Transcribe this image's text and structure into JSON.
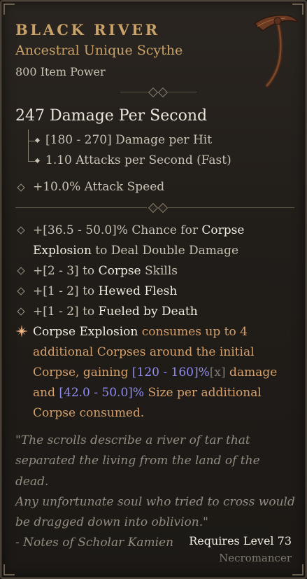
{
  "item": {
    "name": "BLACK RIVER",
    "type": "Ancestral Unique Scythe",
    "power": "800 Item Power",
    "icon": "scythe-icon"
  },
  "stats": {
    "dps": "247 Damage Per Second",
    "damage_per_hit": "[180 - 270] Damage per Hit",
    "attacks_per_second": "1.10 Attacks per Second (Fast)",
    "implicit": "+10.0% Attack Speed"
  },
  "affixes": [
    {
      "pre": "+[36.5 - 50.0]% Chance for ",
      "hl": "Corpse",
      "line2_hl": "Explosion",
      "line2_post": " to Deal Double Damage"
    },
    {
      "pre": "+[2 - 3] to ",
      "hl": "Corpse",
      "post": " Skills"
    },
    {
      "pre": "+[1 - 2] to ",
      "hl": "Hewed Flesh"
    },
    {
      "pre": "+[1 - 2] to ",
      "hl": "Fueled by Death"
    }
  ],
  "unique_power": {
    "l1_skill": "Corpse Explosion",
    "l1_rest": " consumes up to 4",
    "l2": "additional Corpses around the initial",
    "l3_pre": "Corpse, gaining ",
    "l3_range": "[120 - 160]%",
    "l3_x": "[x]",
    "l3_post": " damage",
    "l4_pre": "and ",
    "l4_range": "[42.0 - 50.0]%",
    "l4_post": " Size per additional",
    "l5": "Corpse consumed."
  },
  "flavor": {
    "l1": "\"The scrolls describe a river of tar that",
    "l2": "separated the living from the land of the dead.",
    "l3": "Any unfortunate soul who tried to cross would",
    "l4": "be dragged down into oblivion.\"",
    "l5": "- Notes of Scholar Kamien"
  },
  "requirements": {
    "level": "Requires Level 73",
    "class": "Necromancer"
  },
  "colors": {
    "unique_gold": "#c9a26a",
    "highlight_white": "#f2ece0",
    "range_blue": "#8f8bf0",
    "unique_orange": "#d6a06a",
    "flavor_gray": "#938b7f"
  }
}
